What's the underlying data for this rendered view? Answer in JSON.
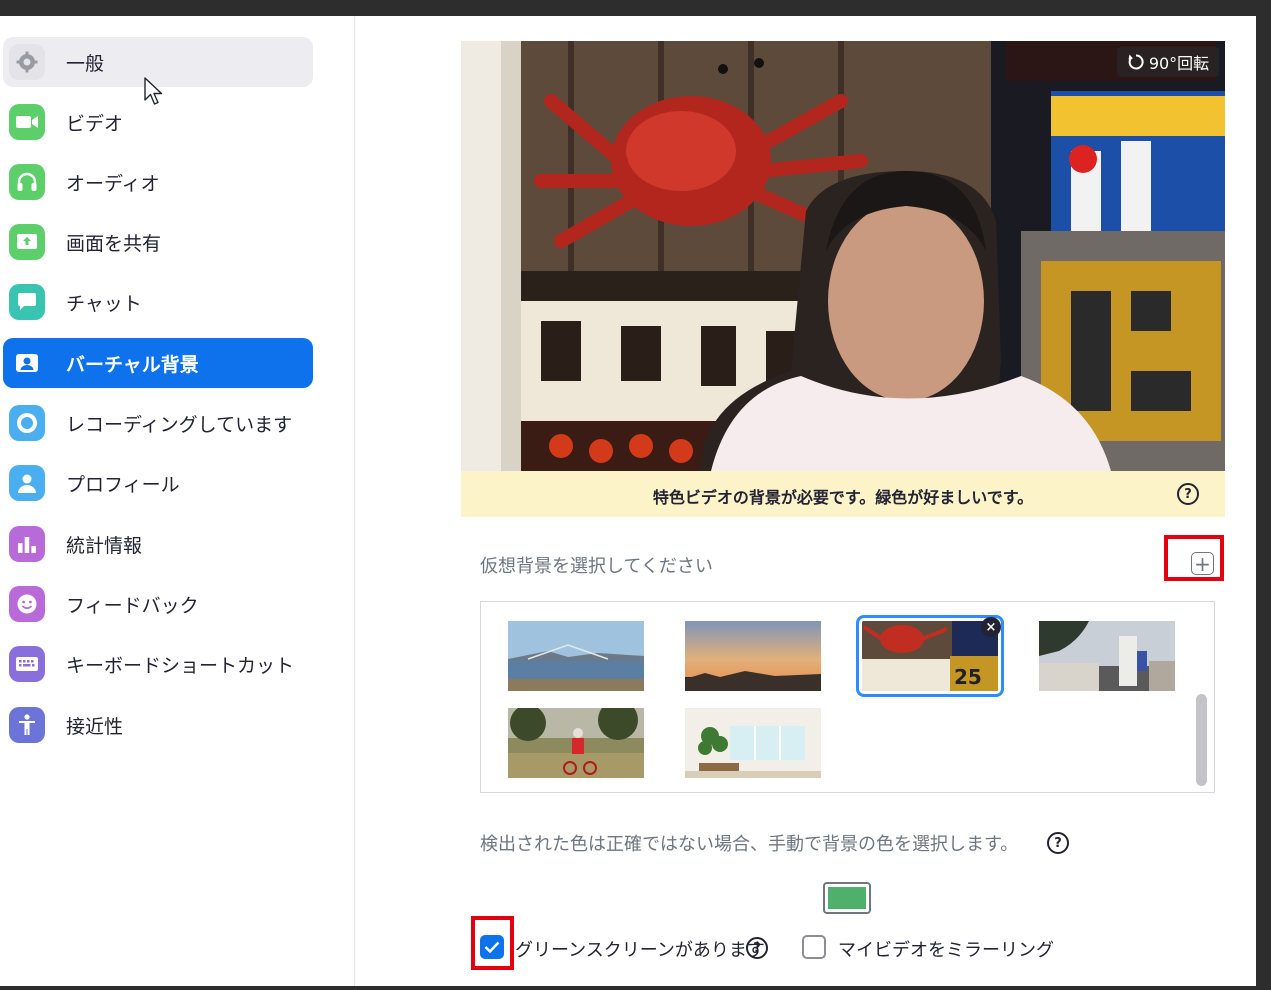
{
  "sidebar": {
    "items": [
      {
        "label": "一般",
        "icon": "gear-icon",
        "color": "#e4e4e8"
      },
      {
        "label": "ビデオ",
        "icon": "video-camera-icon",
        "color": "#5ccf6a"
      },
      {
        "label": "オーディオ",
        "icon": "headphones-icon",
        "color": "#5ccf6a"
      },
      {
        "label": "画面を共有",
        "icon": "share-screen-icon",
        "color": "#5ccf6a"
      },
      {
        "label": "チャット",
        "icon": "chat-icon",
        "color": "#38c4b0"
      },
      {
        "label": "バーチャル背景",
        "icon": "person-card-icon",
        "color": "#0e72ed"
      },
      {
        "label": "レコーディングしています",
        "icon": "record-icon",
        "color": "#4aaef0"
      },
      {
        "label": "プロフィール",
        "icon": "profile-icon",
        "color": "#4aaef0"
      },
      {
        "label": "統計情報",
        "icon": "stats-icon",
        "color": "#b86ad8"
      },
      {
        "label": "フィードバック",
        "icon": "smile-icon",
        "color": "#b86ad8"
      },
      {
        "label": "キーボードショートカット",
        "icon": "keyboard-icon",
        "color": "#8a6fdc"
      },
      {
        "label": "接近性",
        "icon": "accessibility-icon",
        "color": "#6c74d8"
      }
    ],
    "selected_index": 5,
    "hover_index": 0
  },
  "preview": {
    "rotate_label": "90°回転",
    "notice": "特色ビデオの背景が必要です。緑色が好ましいです。",
    "help_glyph": "?"
  },
  "backgrounds": {
    "label": "仮想背景を選択してください",
    "add_glyph": "+",
    "delete_glyph": "×",
    "items": [
      {
        "name": "bridge-bay"
      },
      {
        "name": "sunset"
      },
      {
        "name": "dotonbori-crab"
      },
      {
        "name": "gundam-statue"
      },
      {
        "name": "child-bike"
      },
      {
        "name": "bright-room"
      }
    ],
    "selected_index": 2
  },
  "color_detect": {
    "text": "検出された色は正確ではない場合、手動で背景の色を選択します。",
    "help_glyph": "?",
    "swatch_color": "#4fb06b"
  },
  "options": {
    "green_screen": {
      "label": "グリーンスクリーンがあります",
      "checked": true,
      "help_glyph": "?"
    },
    "mirror": {
      "label": "マイビデオをミラーリング",
      "checked": false
    }
  },
  "colors": {
    "accent": "#0e72ed",
    "annotation_red": "#e3000f",
    "notice_bg": "#fcf3c8"
  }
}
